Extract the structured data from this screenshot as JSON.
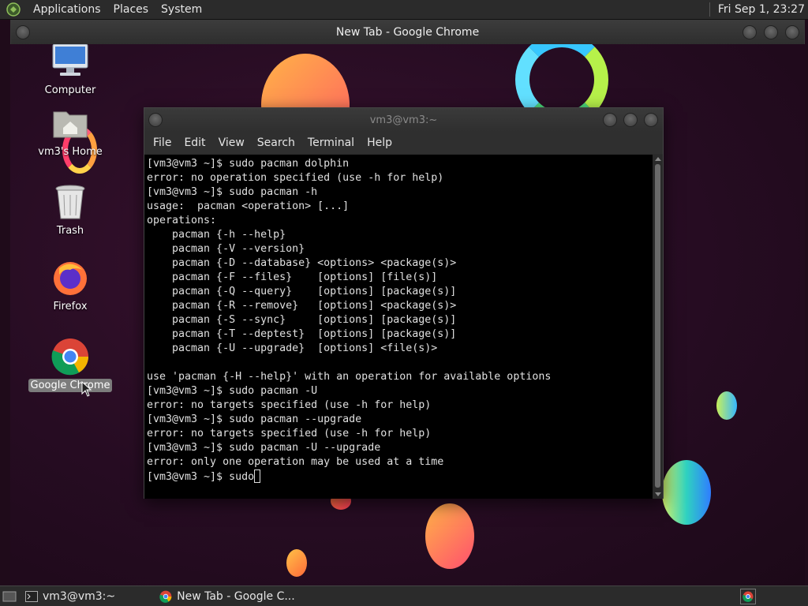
{
  "top_panel": {
    "menus": [
      "Applications",
      "Places",
      "System"
    ],
    "clock": "Fri Sep  1, 23:27"
  },
  "browser_window": {
    "title": "New Tab - Google Chrome"
  },
  "desktop_icons": [
    {
      "label": "Computer",
      "icon": "computer-icon"
    },
    {
      "label": "vm3's Home",
      "icon": "home-folder-icon"
    },
    {
      "label": "Trash",
      "icon": "trash-icon"
    },
    {
      "label": "Firefox",
      "icon": "firefox-icon"
    },
    {
      "label": "Google Chrome",
      "icon": "chrome-icon",
      "selected": true
    }
  ],
  "terminal": {
    "title": "vm3@vm3:~",
    "menu": [
      "File",
      "Edit",
      "View",
      "Search",
      "Terminal",
      "Help"
    ],
    "lines": [
      "[vm3@vm3 ~]$ sudo pacman dolphin",
      "error: no operation specified (use -h for help)",
      "[vm3@vm3 ~]$ sudo pacman -h",
      "usage:  pacman <operation> [...]",
      "operations:",
      "    pacman {-h --help}",
      "    pacman {-V --version}",
      "    pacman {-D --database} <options> <package(s)>",
      "    pacman {-F --files}    [options] [file(s)]",
      "    pacman {-Q --query}    [options] [package(s)]",
      "    pacman {-R --remove}   [options] <package(s)>",
      "    pacman {-S --sync}     [options] [package(s)]",
      "    pacman {-T --deptest}  [options] [package(s)]",
      "    pacman {-U --upgrade}  [options] <file(s)>",
      "",
      "use 'pacman {-H --help}' with an operation for available options",
      "[vm3@vm3 ~]$ sudo pacman -U",
      "error: no targets specified (use -h for help)",
      "[vm3@vm3 ~]$ sudo pacman --upgrade",
      "error: no targets specified (use -h for help)",
      "[vm3@vm3 ~]$ sudo pacman -U --upgrade",
      "error: only one operation may be used at a time"
    ],
    "prompt": "[vm3@vm3 ~]$ sudo"
  },
  "taskbar": {
    "tasks": [
      {
        "label": "vm3@vm3:~",
        "icon": "terminal-icon"
      },
      {
        "label": "New Tab - Google C...",
        "icon": "chrome-icon"
      }
    ]
  },
  "colors": {
    "panel": "#2b2b2b",
    "terminal_bg": "#000000",
    "wallpaper": "#260c22"
  }
}
